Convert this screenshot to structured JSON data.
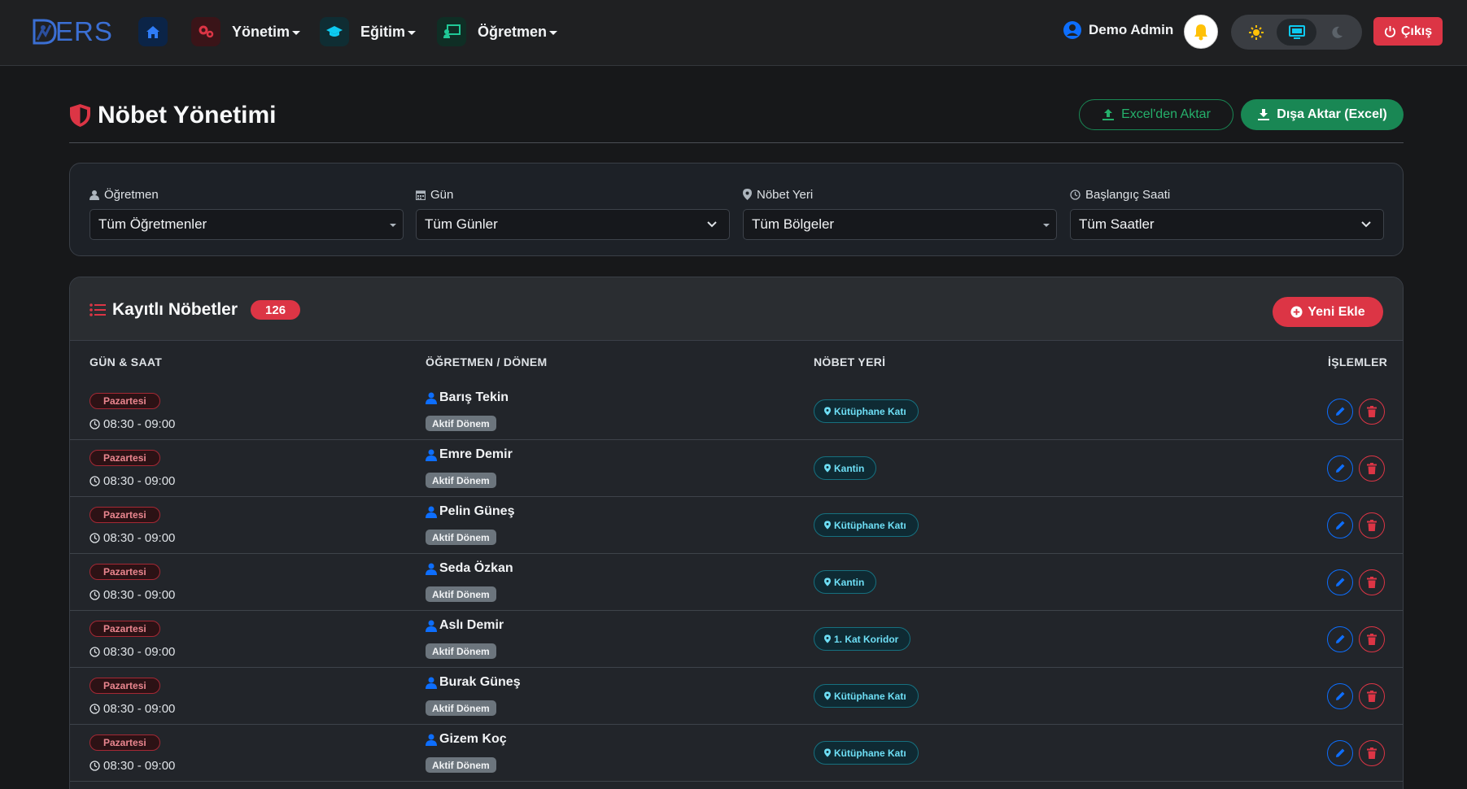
{
  "navbar": {
    "brand": "ERS",
    "menus": [
      {
        "label": "Yönetim",
        "icon": "gears-icon",
        "color": "#dc3545"
      },
      {
        "label": "Eğitim",
        "icon": "graduation-cap-icon",
        "color": "#0dcaf0"
      },
      {
        "label": "Öğretmen",
        "icon": "chalkboard-teacher-icon",
        "color": "#20c997"
      }
    ],
    "user": "Demo Admin",
    "logout": "Çıkış"
  },
  "page": {
    "title": "Nöbet Yönetimi",
    "import_label": "Excel'den Aktar",
    "export_label": "Dışa Aktar (Excel)"
  },
  "filters": {
    "teacher": {
      "label": "Öğretmen",
      "value": "Tüm Öğretmenler"
    },
    "day": {
      "label": "Gün",
      "value": "Tüm Günler"
    },
    "place": {
      "label": "Nöbet Yeri",
      "value": "Tüm Bölgeler"
    },
    "start": {
      "label": "Başlangıç Saati",
      "value": "Tüm Saatler"
    }
  },
  "list": {
    "title": "Kayıtlı Nöbetler",
    "count": "126",
    "new_label": "Yeni Ekle",
    "columns": {
      "day_time": "GÜN & SAAT",
      "teacher": "ÖĞRETMEN / DÖNEM",
      "place": "NÖBET YERİ",
      "actions": "İŞLEMLER"
    },
    "rows": [
      {
        "day": "Pazartesi",
        "time": "08:30 - 09:00",
        "teacher": "Barış Tekin",
        "period": "Aktif Dönem",
        "place": "Kütüphane Katı"
      },
      {
        "day": "Pazartesi",
        "time": "08:30 - 09:00",
        "teacher": "Emre Demir",
        "period": "Aktif Dönem",
        "place": "Kantin"
      },
      {
        "day": "Pazartesi",
        "time": "08:30 - 09:00",
        "teacher": "Pelin Güneş",
        "period": "Aktif Dönem",
        "place": "Kütüphane Katı"
      },
      {
        "day": "Pazartesi",
        "time": "08:30 - 09:00",
        "teacher": "Seda Özkan",
        "period": "Aktif Dönem",
        "place": "Kantin"
      },
      {
        "day": "Pazartesi",
        "time": "08:30 - 09:00",
        "teacher": "Aslı Demir",
        "period": "Aktif Dönem",
        "place": "1. Kat Koridor"
      },
      {
        "day": "Pazartesi",
        "time": "08:30 - 09:00",
        "teacher": "Burak Güneş",
        "period": "Aktif Dönem",
        "place": "Kütüphane Katı"
      },
      {
        "day": "Pazartesi",
        "time": "08:30 - 09:00",
        "teacher": "Gizem Koç",
        "period": "Aktif Dönem",
        "place": "Kütüphane Katı"
      }
    ]
  }
}
